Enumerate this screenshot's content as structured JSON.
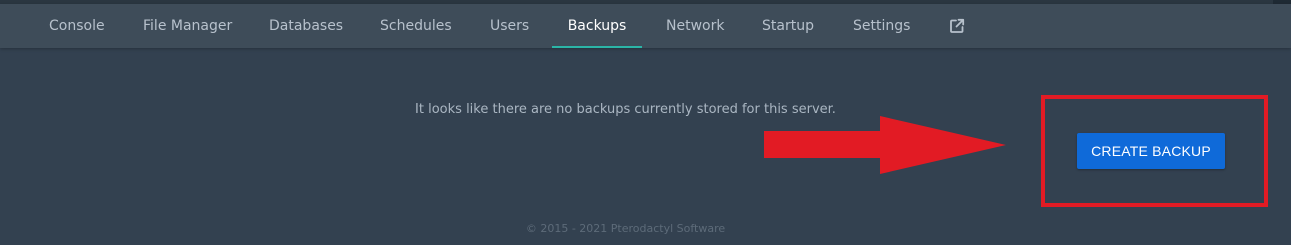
{
  "nav": {
    "tabs": [
      {
        "label": "Console"
      },
      {
        "label": "File Manager"
      },
      {
        "label": "Databases"
      },
      {
        "label": "Schedules"
      },
      {
        "label": "Users"
      },
      {
        "label": "Backups"
      },
      {
        "label": "Network"
      },
      {
        "label": "Startup"
      },
      {
        "label": "Settings"
      }
    ],
    "active_tab": "Backups",
    "external_link_icon": "external-link-icon"
  },
  "backups": {
    "empty_message": "It looks like there are no backups currently stored for this server.",
    "create_button_label": "CREATE BACKUP"
  },
  "annotation": {
    "arrow_icon": "arrow-right-icon",
    "color": "#e21b24"
  },
  "footer": {
    "text": "© 2015 - 2021 Pterodactyl Software"
  },
  "colors": {
    "background": "#334150",
    "navbar": "#3e4c59",
    "accent_underline": "#2bb5a7",
    "primary_button": "#0f6ad9"
  }
}
